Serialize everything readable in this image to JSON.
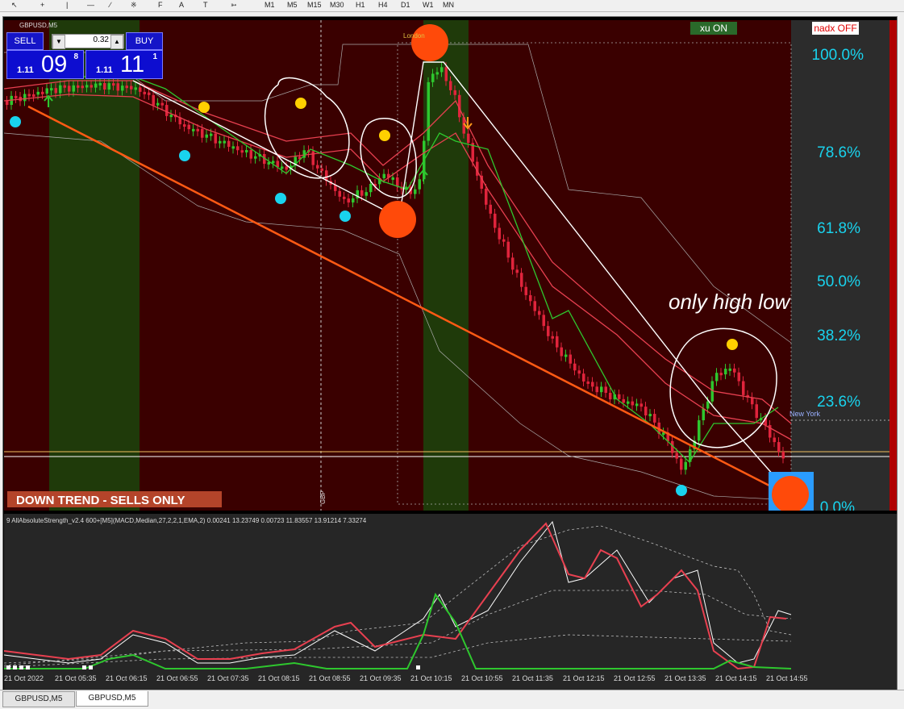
{
  "toolbar": {
    "timeframes": [
      "M1",
      "M5",
      "M15",
      "M30",
      "H1",
      "H4",
      "D1",
      "W1",
      "MN"
    ]
  },
  "chart": {
    "symbol_title": "GBPUSD,M5",
    "session_london": "London",
    "session_new_york": "New York",
    "vertical_marker": "GBP",
    "trend_banner": "DOWN TREND - SELLS ONLY",
    "handwritten_note": "only high low",
    "badge_xu": "xu ON",
    "badge_nadx": "nadx OFF",
    "fib_levels": [
      "100.0%",
      "78.6%",
      "61.8%",
      "50.0%",
      "38.2%",
      "23.6%",
      "0.0%"
    ],
    "colors": {
      "background": "#3a0000",
      "session_green": "#1f3a0a",
      "bear": "#e0243c",
      "bull": "#2ec72e",
      "fib": "#19d3ee",
      "trendline": "#ff5a14",
      "banner": "#b4442a"
    }
  },
  "trade_panel": {
    "sell_label": "SELL",
    "buy_label": "BUY",
    "lot": "0.32",
    "bid_prefix": "1.11",
    "bid_big": "09",
    "bid_sup": "8",
    "ask_prefix": "1.11",
    "ask_big": "11",
    "ask_sup": "1"
  },
  "indicator": {
    "title": "9 AllAbsoluteStrength_v2.4 600+[M5](MACD,Median,27,2,2,1,EMA,2) 0.00241 13.23749 0.00723 11.83557 13.91214 7.33274"
  },
  "time_axis": [
    "21 Oct 2022",
    "21 Oct 05:35",
    "21 Oct 06:15",
    "21 Oct 06:55",
    "21 Oct 07:35",
    "21 Oct 08:15",
    "21 Oct 08:55",
    "21 Oct 09:35",
    "21 Oct 10:15",
    "21 Oct 10:55",
    "21 Oct 11:35",
    "21 Oct 12:15",
    "21 Oct 12:55",
    "21 Oct 13:35",
    "21 Oct 14:15",
    "21 Oct 14:55"
  ],
  "tabs": [
    "GBPUSD,M5",
    "GBPUSD,M5"
  ]
}
